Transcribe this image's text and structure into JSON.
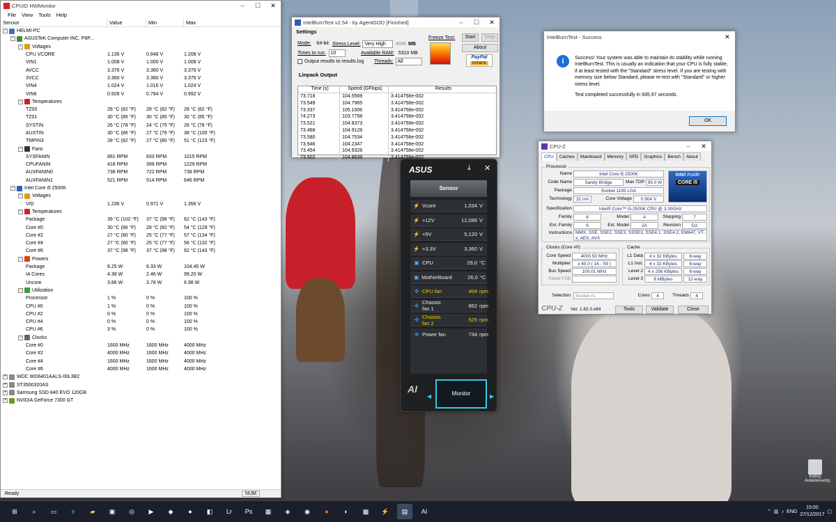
{
  "hwmonitor": {
    "title": "CPUID HWMonitor",
    "menu": [
      "File",
      "View",
      "Tools",
      "Help"
    ],
    "columns": [
      "Sensor",
      "Value",
      "Min",
      "Max"
    ],
    "rows": [
      {
        "level": 0,
        "kind": "tree",
        "label": "HELMI-PC",
        "value": "",
        "min": "",
        "max": "",
        "icon": "pc"
      },
      {
        "level": 1,
        "kind": "tree",
        "label": "ASUSTeK Computer INC. P8P...",
        "value": "",
        "min": "",
        "max": "",
        "icon": "board"
      },
      {
        "level": 2,
        "kind": "tree",
        "label": "Voltages",
        "value": "",
        "min": "",
        "max": "",
        "icon": "volt"
      },
      {
        "level": 3,
        "kind": "leaf",
        "label": "CPU VCORE",
        "value": "1.136 V",
        "min": "0.848 V",
        "max": "1.208 V"
      },
      {
        "level": 3,
        "kind": "leaf",
        "label": "VIN1",
        "value": "1.008 V",
        "min": "1.000 V",
        "max": "1.008 V"
      },
      {
        "level": 3,
        "kind": "leaf",
        "label": "AVCC",
        "value": "3.376 V",
        "min": "3.360 V",
        "max": "3.376 V"
      },
      {
        "level": 3,
        "kind": "leaf",
        "label": "3VCC",
        "value": "3.360 V",
        "min": "3.360 V",
        "max": "3.376 V"
      },
      {
        "level": 3,
        "kind": "leaf",
        "label": "VIN4",
        "value": "1.024 V",
        "min": "1.016 V",
        "max": "1.024 V"
      },
      {
        "level": 3,
        "kind": "leaf",
        "label": "VIN6",
        "value": "0.928 V",
        "min": "0.784 V",
        "max": "0.992 V"
      },
      {
        "level": 2,
        "kind": "tree",
        "label": "Temperatures",
        "value": "",
        "min": "",
        "max": "",
        "icon": "temp"
      },
      {
        "level": 3,
        "kind": "leaf",
        "label": "TZ00",
        "value": "28 °C  (82 °F)",
        "min": "28 °C  (82 °F)",
        "max": "28 °C  (82 °F)"
      },
      {
        "level": 3,
        "kind": "leaf",
        "label": "TZ01",
        "value": "30 °C  (85 °F)",
        "min": "30 °C  (85 °F)",
        "max": "30 °C  (85 °F)"
      },
      {
        "level": 3,
        "kind": "leaf",
        "label": "SYSTIN",
        "value": "26 °C  (78 °F)",
        "min": "24 °C  (75 °F)",
        "max": "26 °C  (78 °F)"
      },
      {
        "level": 3,
        "kind": "leaf",
        "label": "AUXTIN",
        "value": "30 °C  (86 °F)",
        "min": "27 °C  (79 °F)",
        "max": "38 °C  (100 °F)"
      },
      {
        "level": 3,
        "kind": "leaf",
        "label": "TMPIN3",
        "value": "28 °C  (82 °F)",
        "min": "27 °C  (80 °F)",
        "max": "51 °C  (123 °F)"
      },
      {
        "level": 2,
        "kind": "tree",
        "label": "Fans",
        "value": "",
        "min": "",
        "max": "",
        "icon": "fan"
      },
      {
        "level": 3,
        "kind": "leaf",
        "label": "SYSFANIN",
        "value": "861 RPM",
        "min": "833 RPM",
        "max": "1015 RPM"
      },
      {
        "level": 3,
        "kind": "leaf",
        "label": "CPUFANIN",
        "value": "418 RPM",
        "min": "399 RPM",
        "max": "1229 RPM"
      },
      {
        "level": 3,
        "kind": "leaf",
        "label": "AUXFANIN0",
        "value": "738 RPM",
        "min": "722 RPM",
        "max": "738 RPM"
      },
      {
        "level": 3,
        "kind": "leaf",
        "label": "AUXFANIN1",
        "value": "521 RPM",
        "min": "514 RPM",
        "max": "646 RPM"
      },
      {
        "level": 1,
        "kind": "tree",
        "label": "Intel Core i5 2500K",
        "value": "",
        "min": "",
        "max": "",
        "icon": "cpu"
      },
      {
        "level": 2,
        "kind": "tree",
        "label": "Voltages",
        "value": "",
        "min": "",
        "max": "",
        "icon": "volt"
      },
      {
        "level": 3,
        "kind": "leaf",
        "label": "VID",
        "value": "1.236 V",
        "min": "0.971 V",
        "max": "1.356 V"
      },
      {
        "level": 2,
        "kind": "tree",
        "label": "Temperatures",
        "value": "",
        "min": "",
        "max": "",
        "icon": "temp"
      },
      {
        "level": 3,
        "kind": "leaf",
        "label": "Package",
        "value": "39 °C  (102 °F)",
        "min": "37 °C  (98 °F)",
        "max": "62 °C  (143 °F)"
      },
      {
        "level": 3,
        "kind": "leaf",
        "label": "Core #0",
        "value": "30 °C  (86 °F)",
        "min": "28 °C  (82 °F)",
        "max": "54 °C  (129 °F)"
      },
      {
        "level": 3,
        "kind": "leaf",
        "label": "Core #2",
        "value": "27 °C  (80 °F)",
        "min": "25 °C  (77 °F)",
        "max": "57 °C  (134 °F)"
      },
      {
        "level": 3,
        "kind": "leaf",
        "label": "Core #4",
        "value": "27 °C  (80 °F)",
        "min": "25 °C  (77 °F)",
        "max": "56 °C  (132 °F)"
      },
      {
        "level": 3,
        "kind": "leaf",
        "label": "Core #6",
        "value": "37 °C  (98 °F)",
        "min": "37 °C  (98 °F)",
        "max": "62 °C  (143 °F)"
      },
      {
        "level": 2,
        "kind": "tree",
        "label": "Powers",
        "value": "",
        "min": "",
        "max": "",
        "icon": "power"
      },
      {
        "level": 3,
        "kind": "leaf",
        "label": "Package",
        "value": "8.25 W",
        "min": "6.33 W",
        "max": "104.45 W"
      },
      {
        "level": 3,
        "kind": "leaf",
        "label": "IA Cores",
        "value": "4.38 W",
        "min": "2.46 W",
        "max": "99.20 W"
      },
      {
        "level": 3,
        "kind": "leaf",
        "label": "Uncore",
        "value": "3.86 W",
        "min": "3.78 W",
        "max": "6.98 W"
      },
      {
        "level": 2,
        "kind": "tree",
        "label": "Utilization",
        "value": "",
        "min": "",
        "max": "",
        "icon": "util"
      },
      {
        "level": 3,
        "kind": "leaf",
        "label": "Processor",
        "value": "1 %",
        "min": "0 %",
        "max": "100 %"
      },
      {
        "level": 3,
        "kind": "leaf",
        "label": "CPU #0",
        "value": "1 %",
        "min": "0 %",
        "max": "100 %"
      },
      {
        "level": 3,
        "kind": "leaf",
        "label": "CPU #2",
        "value": "0 %",
        "min": "0 %",
        "max": "100 %"
      },
      {
        "level": 3,
        "kind": "leaf",
        "label": "CPU #4",
        "value": "0 %",
        "min": "0 %",
        "max": "100 %"
      },
      {
        "level": 3,
        "kind": "leaf",
        "label": "CPU #6",
        "value": "3 %",
        "min": "0 %",
        "max": "100 %"
      },
      {
        "level": 2,
        "kind": "tree",
        "label": "Clocks",
        "value": "",
        "min": "",
        "max": "",
        "icon": "clock"
      },
      {
        "level": 3,
        "kind": "leaf",
        "label": "Core #0",
        "value": "1600 MHz",
        "min": "1600 MHz",
        "max": "4000 MHz"
      },
      {
        "level": 3,
        "kind": "leaf",
        "label": "Core #2",
        "value": "4000 MHz",
        "min": "1600 MHz",
        "max": "4000 MHz"
      },
      {
        "level": 3,
        "kind": "leaf",
        "label": "Core #4",
        "value": "1600 MHz",
        "min": "1600 MHz",
        "max": "4000 MHz"
      },
      {
        "level": 3,
        "kind": "leaf",
        "label": "Core #6",
        "value": "4000 MHz",
        "min": "1600 MHz",
        "max": "4000 MHz"
      },
      {
        "level": 0,
        "kind": "tree",
        "label": "WDC WD6401AALS-00L3B2",
        "value": "",
        "min": "",
        "max": "",
        "icon": "disk",
        "collapsed": true
      },
      {
        "level": 0,
        "kind": "tree",
        "label": "ST3500320AS",
        "value": "",
        "min": "",
        "max": "",
        "icon": "disk",
        "collapsed": true
      },
      {
        "level": 0,
        "kind": "tree",
        "label": "Samsung SSD 840 EVO 120GB",
        "value": "",
        "min": "",
        "max": "",
        "icon": "disk",
        "collapsed": true
      },
      {
        "level": 0,
        "kind": "tree",
        "label": "NVIDIA GeForce 7300 GT",
        "value": "",
        "min": "",
        "max": "",
        "icon": "gpu",
        "collapsed": true
      }
    ],
    "status": "Ready",
    "num": "NUM"
  },
  "ibt": {
    "title": "IntelBurnTest v2.54 - by AgentGOD [Finished]",
    "settings_label": "Settings",
    "mode_label": "Mode:",
    "mode_value": "64-bit",
    "stress_label": "Stress Level:",
    "stress_value": "Very High",
    "stress_mb": "4096",
    "mb_label": "MB",
    "times_label": "Times to run:",
    "times_value": "10",
    "avail_label": "Available RAM:",
    "avail_value": "5310 MB",
    "threads_label": "Threads:",
    "threads_value": "All",
    "output_label": "Output results to results.log",
    "freeze_label": "Freeze Test:",
    "start": "Start",
    "stop": "Stop",
    "about": "About",
    "paypal": "PayPal",
    "donate": "DONATE",
    "linpack_label": "Linpack Output",
    "cols": [
      "Time (s)",
      "Speed (GFlops)",
      "Results"
    ],
    "rows": [
      [
        "73.718",
        "104.5569",
        "3.414758e-002"
      ],
      [
        "73.549",
        "104.7965",
        "3.414758e-002"
      ],
      [
        "73.337",
        "105.1006",
        "3.414758e-002"
      ],
      [
        "74.273",
        "103.7758",
        "3.414758e-002"
      ],
      [
        "73.521",
        "104.8373",
        "3.414758e-002"
      ],
      [
        "73.468",
        "104.9128",
        "3.414758e-002"
      ],
      [
        "73.580",
        "104.7534",
        "3.414758e-002"
      ],
      [
        "73.946",
        "104.2347",
        "3.414758e-002"
      ],
      [
        "73.454",
        "104.9328",
        "3.414758e-002"
      ],
      [
        "73.502",
        "104.8639",
        "3.414758e-002"
      ]
    ]
  },
  "dialog": {
    "title": "IntelBurnTest - Success",
    "message": "Success! Your system was able to maintain its stability while running IntelBurnTest. This is usually an indication that your CPU is fully stable, if at least tested with the \"Standard\" stress level. If you are testing with memory size below Standard, please re-test with \"Standard\" or higher stress level.",
    "completed": "Test completed successfully in 935,97 seconds.",
    "ok": "OK"
  },
  "cpuz": {
    "title": "CPU-Z",
    "tabs": [
      "CPU",
      "Caches",
      "Mainboard",
      "Memory",
      "SPD",
      "Graphics",
      "Bench",
      "About"
    ],
    "processor_label": "Processor",
    "name_label": "Name",
    "name": "Intel Core i5 2500K",
    "codename_label": "Code Name",
    "codename": "Sandy Bridge",
    "maxtdp_label": "Max TDP",
    "maxtdp": "95.0 W",
    "package_label": "Package",
    "package": "Socket 1155 LGA",
    "tech_label": "Technology",
    "tech": "32 nm",
    "corev_label": "Core Voltage",
    "corev": "0.904 V",
    "spec_label": "Specification",
    "spec": "Intel® Core™ i5-2500K CPU @ 3.30GHz",
    "family_label": "Family",
    "family": "6",
    "model_label": "Model",
    "model": "A",
    "stepping_label": "Stepping",
    "stepping": "7",
    "extfam_label": "Ext. Family",
    "extfam": "6",
    "extmod_label": "Ext. Model",
    "extmod": "2A",
    "rev_label": "Revision",
    "rev": "D2",
    "instr_label": "Instructions",
    "instr": "MMX, SSE, SSE2, SSE3, SSSE3, SSE4.1, SSE4.2, EM64T, VT-x, AES, AVX",
    "clocks_label": "Clocks (Core #0)",
    "corespeed_label": "Core Speed",
    "corespeed": "4000.50 MHz",
    "mult_label": "Multiplier",
    "mult": "x 40.0 ( 16 - 59 )",
    "bus_label": "Bus Speed",
    "bus": "100.01 MHz",
    "fsb_label": "Rated FSB",
    "fsb": "",
    "cache_label": "Cache",
    "l1d_label": "L1 Data",
    "l1d": "4 x 32 KBytes",
    "l1d_w": "8-way",
    "l1i_label": "L1 Inst.",
    "l1i": "4 x 32 KBytes",
    "l1i_w": "8-way",
    "l2_label": "Level 2",
    "l2": "4 x 256 KBytes",
    "l2_w": "8-way",
    "l3_label": "Level 3",
    "l3": "6 MBytes",
    "l3_w": "12-way",
    "sel_label": "Selection",
    "sel": "Socket #1",
    "cores_label": "Cores",
    "cores": "4",
    "threads_label": "Threads",
    "threads": "4",
    "brand": "CPU-Z",
    "version": "Ver. 1.82.0.x64",
    "tools": "Tools",
    "validate": "Validate",
    "close": "Close",
    "badge_top": "intel",
    "badge_inside": "inside",
    "badge_core": "CORE i5"
  },
  "asus": {
    "brand": "ASUS",
    "tab": "Sensor",
    "monitor": "Monitor",
    "sensors": [
      {
        "name": "Vcore",
        "value": "1,034",
        "unit": "V",
        "hl": false
      },
      {
        "name": "+12V",
        "value": "12,096",
        "unit": "V",
        "hl": false
      },
      {
        "name": "+5V",
        "value": "5,120",
        "unit": "V",
        "hl": false
      },
      {
        "name": "+3.3V",
        "value": "3,360",
        "unit": "V",
        "hl": false
      },
      {
        "name": "CPU",
        "value": "29,0",
        "unit": "°C",
        "hl": false
      },
      {
        "name": "MotherBoard",
        "value": "26,0",
        "unit": "°C",
        "hl": false
      },
      {
        "name": "CPU fan",
        "value": "404",
        "unit": "rpm",
        "hl": true
      },
      {
        "name": "Chassis fan 1",
        "value": "862",
        "unit": "rpm",
        "hl": false
      },
      {
        "name": "Chassis fan 2",
        "value": "525",
        "unit": "rpm",
        "hl": true
      },
      {
        "name": "Power fan",
        "value": "734",
        "unit": "rpm",
        "hl": false
      }
    ]
  },
  "desktop": {
    "recycle": "Κάδος Ανακύκλωσης"
  },
  "taskbar": {
    "lang": "ENG",
    "time": "15:00",
    "date": "27/12/2017"
  }
}
